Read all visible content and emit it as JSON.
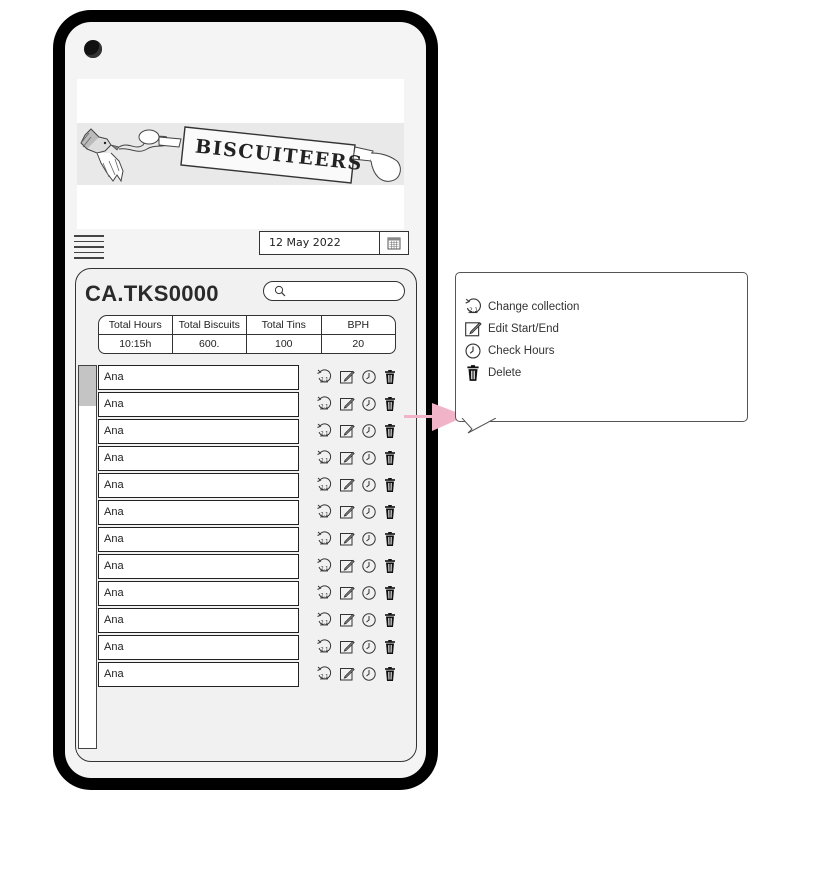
{
  "brand": {
    "logo_text": "BISCUITEERS"
  },
  "date_picker": {
    "value": "12 May 2022",
    "icon": "calendar-icon"
  },
  "panel": {
    "title": "CA.TKS0000",
    "search": {
      "placeholder": "",
      "icon": "search-icon"
    }
  },
  "stats": {
    "headers": [
      "Total Hours",
      "Total Biscuits",
      "Total Tins",
      "BPH"
    ],
    "values": [
      "10:15h",
      "600.",
      "100",
      "20"
    ]
  },
  "rows": [
    {
      "name": "Ana"
    },
    {
      "name": "Ana"
    },
    {
      "name": "Ana"
    },
    {
      "name": "Ana"
    },
    {
      "name": "Ana"
    },
    {
      "name": "Ana"
    },
    {
      "name": "Ana"
    },
    {
      "name": "Ana"
    },
    {
      "name": "Ana"
    },
    {
      "name": "Ana"
    },
    {
      "name": "Ana"
    },
    {
      "name": "Ana"
    }
  ],
  "row_actions": [
    "change-collection-icon",
    "edit-icon",
    "clock-icon",
    "trash-icon"
  ],
  "legend": {
    "items": [
      {
        "icon": "change-collection-icon",
        "label": "Change collection"
      },
      {
        "icon": "edit-icon",
        "label": "Edit Start/End"
      },
      {
        "icon": "clock-icon",
        "label": "Check Hours"
      },
      {
        "icon": "trash-icon",
        "label": "Delete"
      }
    ]
  },
  "colors": {
    "arrow": "#f0b3c8",
    "frame": "#000000",
    "screen": "#f4f4f4"
  }
}
